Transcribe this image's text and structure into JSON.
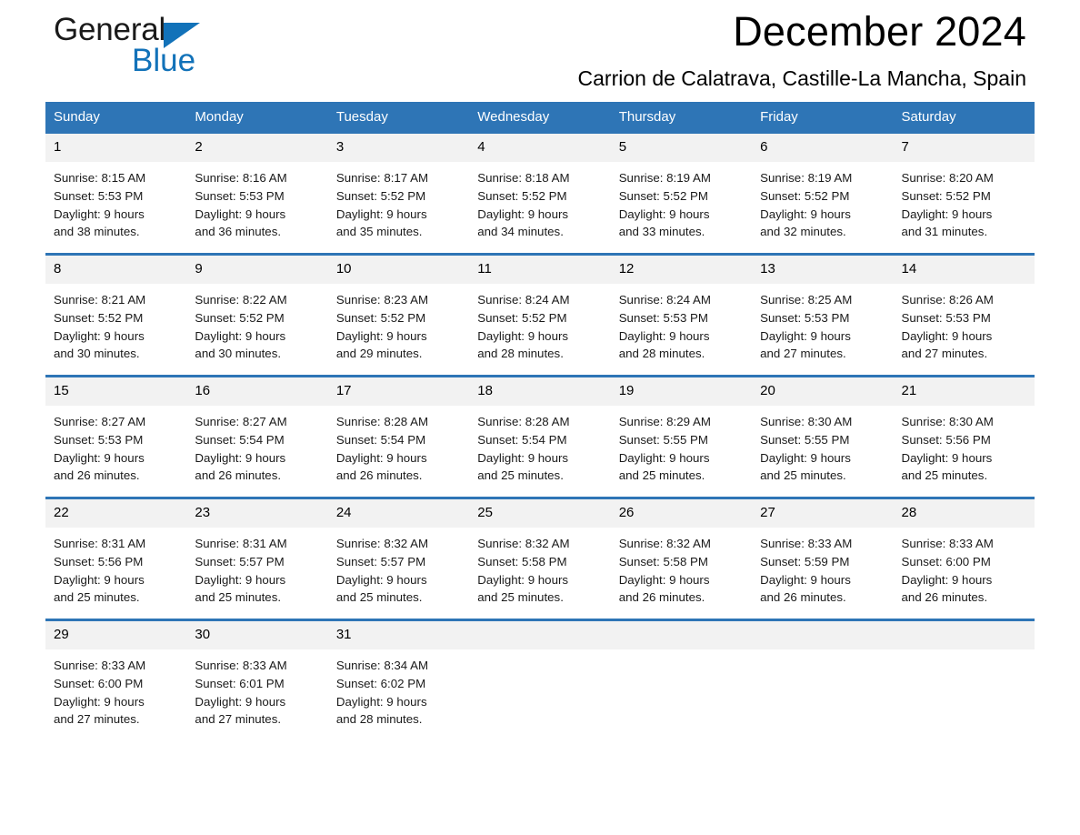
{
  "brand": {
    "name_part1": "General",
    "name_part2": "Blue",
    "accent_color": "#1272B9"
  },
  "header": {
    "title": "December 2024",
    "subtitle": "Carrion de Calatrava, Castille-La Mancha, Spain",
    "header_bg_color": "#2E75B6",
    "daynum_bg_color": "#F2F2F2"
  },
  "weekdays": [
    "Sunday",
    "Monday",
    "Tuesday",
    "Wednesday",
    "Thursday",
    "Friday",
    "Saturday"
  ],
  "weeks": [
    [
      {
        "day": "1",
        "sunrise": "Sunrise: 8:15 AM",
        "sunset": "Sunset: 5:53 PM",
        "daylight1": "Daylight: 9 hours",
        "daylight2": "and 38 minutes."
      },
      {
        "day": "2",
        "sunrise": "Sunrise: 8:16 AM",
        "sunset": "Sunset: 5:53 PM",
        "daylight1": "Daylight: 9 hours",
        "daylight2": "and 36 minutes."
      },
      {
        "day": "3",
        "sunrise": "Sunrise: 8:17 AM",
        "sunset": "Sunset: 5:52 PM",
        "daylight1": "Daylight: 9 hours",
        "daylight2": "and 35 minutes."
      },
      {
        "day": "4",
        "sunrise": "Sunrise: 8:18 AM",
        "sunset": "Sunset: 5:52 PM",
        "daylight1": "Daylight: 9 hours",
        "daylight2": "and 34 minutes."
      },
      {
        "day": "5",
        "sunrise": "Sunrise: 8:19 AM",
        "sunset": "Sunset: 5:52 PM",
        "daylight1": "Daylight: 9 hours",
        "daylight2": "and 33 minutes."
      },
      {
        "day": "6",
        "sunrise": "Sunrise: 8:19 AM",
        "sunset": "Sunset: 5:52 PM",
        "daylight1": "Daylight: 9 hours",
        "daylight2": "and 32 minutes."
      },
      {
        "day": "7",
        "sunrise": "Sunrise: 8:20 AM",
        "sunset": "Sunset: 5:52 PM",
        "daylight1": "Daylight: 9 hours",
        "daylight2": "and 31 minutes."
      }
    ],
    [
      {
        "day": "8",
        "sunrise": "Sunrise: 8:21 AM",
        "sunset": "Sunset: 5:52 PM",
        "daylight1": "Daylight: 9 hours",
        "daylight2": "and 30 minutes."
      },
      {
        "day": "9",
        "sunrise": "Sunrise: 8:22 AM",
        "sunset": "Sunset: 5:52 PM",
        "daylight1": "Daylight: 9 hours",
        "daylight2": "and 30 minutes."
      },
      {
        "day": "10",
        "sunrise": "Sunrise: 8:23 AM",
        "sunset": "Sunset: 5:52 PM",
        "daylight1": "Daylight: 9 hours",
        "daylight2": "and 29 minutes."
      },
      {
        "day": "11",
        "sunrise": "Sunrise: 8:24 AM",
        "sunset": "Sunset: 5:52 PM",
        "daylight1": "Daylight: 9 hours",
        "daylight2": "and 28 minutes."
      },
      {
        "day": "12",
        "sunrise": "Sunrise: 8:24 AM",
        "sunset": "Sunset: 5:53 PM",
        "daylight1": "Daylight: 9 hours",
        "daylight2": "and 28 minutes."
      },
      {
        "day": "13",
        "sunrise": "Sunrise: 8:25 AM",
        "sunset": "Sunset: 5:53 PM",
        "daylight1": "Daylight: 9 hours",
        "daylight2": "and 27 minutes."
      },
      {
        "day": "14",
        "sunrise": "Sunrise: 8:26 AM",
        "sunset": "Sunset: 5:53 PM",
        "daylight1": "Daylight: 9 hours",
        "daylight2": "and 27 minutes."
      }
    ],
    [
      {
        "day": "15",
        "sunrise": "Sunrise: 8:27 AM",
        "sunset": "Sunset: 5:53 PM",
        "daylight1": "Daylight: 9 hours",
        "daylight2": "and 26 minutes."
      },
      {
        "day": "16",
        "sunrise": "Sunrise: 8:27 AM",
        "sunset": "Sunset: 5:54 PM",
        "daylight1": "Daylight: 9 hours",
        "daylight2": "and 26 minutes."
      },
      {
        "day": "17",
        "sunrise": "Sunrise: 8:28 AM",
        "sunset": "Sunset: 5:54 PM",
        "daylight1": "Daylight: 9 hours",
        "daylight2": "and 26 minutes."
      },
      {
        "day": "18",
        "sunrise": "Sunrise: 8:28 AM",
        "sunset": "Sunset: 5:54 PM",
        "daylight1": "Daylight: 9 hours",
        "daylight2": "and 25 minutes."
      },
      {
        "day": "19",
        "sunrise": "Sunrise: 8:29 AM",
        "sunset": "Sunset: 5:55 PM",
        "daylight1": "Daylight: 9 hours",
        "daylight2": "and 25 minutes."
      },
      {
        "day": "20",
        "sunrise": "Sunrise: 8:30 AM",
        "sunset": "Sunset: 5:55 PM",
        "daylight1": "Daylight: 9 hours",
        "daylight2": "and 25 minutes."
      },
      {
        "day": "21",
        "sunrise": "Sunrise: 8:30 AM",
        "sunset": "Sunset: 5:56 PM",
        "daylight1": "Daylight: 9 hours",
        "daylight2": "and 25 minutes."
      }
    ],
    [
      {
        "day": "22",
        "sunrise": "Sunrise: 8:31 AM",
        "sunset": "Sunset: 5:56 PM",
        "daylight1": "Daylight: 9 hours",
        "daylight2": "and 25 minutes."
      },
      {
        "day": "23",
        "sunrise": "Sunrise: 8:31 AM",
        "sunset": "Sunset: 5:57 PM",
        "daylight1": "Daylight: 9 hours",
        "daylight2": "and 25 minutes."
      },
      {
        "day": "24",
        "sunrise": "Sunrise: 8:32 AM",
        "sunset": "Sunset: 5:57 PM",
        "daylight1": "Daylight: 9 hours",
        "daylight2": "and 25 minutes."
      },
      {
        "day": "25",
        "sunrise": "Sunrise: 8:32 AM",
        "sunset": "Sunset: 5:58 PM",
        "daylight1": "Daylight: 9 hours",
        "daylight2": "and 25 minutes."
      },
      {
        "day": "26",
        "sunrise": "Sunrise: 8:32 AM",
        "sunset": "Sunset: 5:58 PM",
        "daylight1": "Daylight: 9 hours",
        "daylight2": "and 26 minutes."
      },
      {
        "day": "27",
        "sunrise": "Sunrise: 8:33 AM",
        "sunset": "Sunset: 5:59 PM",
        "daylight1": "Daylight: 9 hours",
        "daylight2": "and 26 minutes."
      },
      {
        "day": "28",
        "sunrise": "Sunrise: 8:33 AM",
        "sunset": "Sunset: 6:00 PM",
        "daylight1": "Daylight: 9 hours",
        "daylight2": "and 26 minutes."
      }
    ],
    [
      {
        "day": "29",
        "sunrise": "Sunrise: 8:33 AM",
        "sunset": "Sunset: 6:00 PM",
        "daylight1": "Daylight: 9 hours",
        "daylight2": "and 27 minutes."
      },
      {
        "day": "30",
        "sunrise": "Sunrise: 8:33 AM",
        "sunset": "Sunset: 6:01 PM",
        "daylight1": "Daylight: 9 hours",
        "daylight2": "and 27 minutes."
      },
      {
        "day": "31",
        "sunrise": "Sunrise: 8:34 AM",
        "sunset": "Sunset: 6:02 PM",
        "daylight1": "Daylight: 9 hours",
        "daylight2": "and 28 minutes."
      },
      {
        "day": "",
        "sunrise": "",
        "sunset": "",
        "daylight1": "",
        "daylight2": ""
      },
      {
        "day": "",
        "sunrise": "",
        "sunset": "",
        "daylight1": "",
        "daylight2": ""
      },
      {
        "day": "",
        "sunrise": "",
        "sunset": "",
        "daylight1": "",
        "daylight2": ""
      },
      {
        "day": "",
        "sunrise": "",
        "sunset": "",
        "daylight1": "",
        "daylight2": ""
      }
    ]
  ]
}
